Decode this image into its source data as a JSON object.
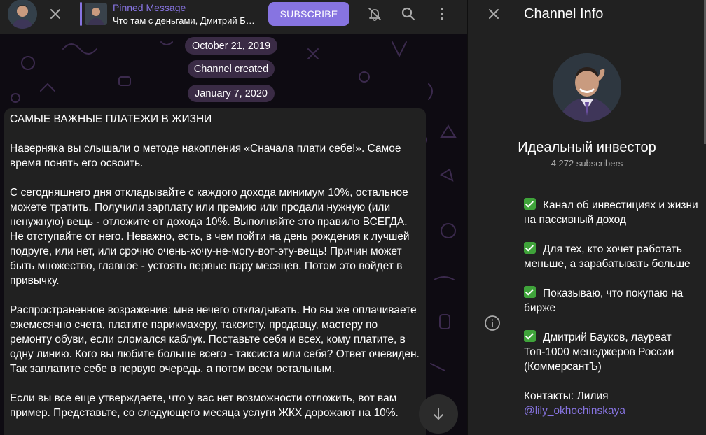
{
  "header": {
    "pinned_label": "Pinned Message",
    "pinned_text": "Что там с деньгами, Дмитрий Бауков?",
    "subscribe_label": "SUBSCRIBE"
  },
  "chat": {
    "date_1": "October 21, 2019",
    "service_message": "Channel created",
    "date_2": "January 7, 2020",
    "message": {
      "title": "САМЫЕ ВАЖНЫЕ ПЛАТЕЖИ В ЖИЗНИ",
      "paragraphs": [
        "Наверняка вы слышали о методе накопления «Сначала плати себе!». Самое время понять его освоить.",
        "С сегодняшнего дня откладывайте с каждого дохода минимум 10%, остальное можете тратить. Получили зарплату или премию или продали нужную (или ненужную) вещь - отложите от дохода 10%. Выполняйте это правило ВСЕГДА. Не отступайте от него. Неважно, есть, в чем пойти на день рождения к лучшей подруге, или нет, или срочно очень-хочу-не-могу-вот-эту-вещь! Причин может быть множество, главное - устоять первые пару месяцев. Потом это войдет в привычку.",
        "Распространенное возражение: мне нечего откладывать. Но вы же оплачиваете ежемесячно счета, платите парикмахеру, таксисту, продавцу, мастеру по ремонту обуви, если сломался каблук. Поставьте себя и всех, кому платите, в одну линию. Кого вы любите больше всего - таксиста или себя? Ответ очевиден. Так заплатите себе в первую очередь, а потом всем остальным.",
        "Если вы все еще утверждаете, что у вас нет возможности отложить, вот вам пример. Представьте, со следующего месяца услуги ЖКХ дорожают на 10%."
      ]
    }
  },
  "info": {
    "title": "Channel Info",
    "channel_name": "Идеальный инвестор",
    "subscribers": "4 272 subscribers",
    "about": [
      "Канал об инвестициях и жизни на пассивный  доход",
      "Для тех, кто хочет работать меньше, а зарабатывать больше",
      "Показываю, что покупаю на бирже",
      "Дмитрий Бауков, лауреат Топ-1000 менеджеров России (КоммерсантЪ)"
    ],
    "contacts_label": "Контакты: Лилия",
    "contacts_link": "@lily_okhochinskaya"
  },
  "icons": {
    "close": "close-icon",
    "mute": "bell-off-icon",
    "search": "search-icon",
    "more": "more-vertical-icon",
    "scroll_down": "arrow-down-icon",
    "info": "info-icon",
    "check": "check-emoji-icon"
  },
  "colors": {
    "accent": "#8774e1",
    "panel_bg": "#212121",
    "chat_bg": "#0e0b12",
    "pill_bg": "#3a2b45",
    "check_green": "#3fa33a"
  }
}
